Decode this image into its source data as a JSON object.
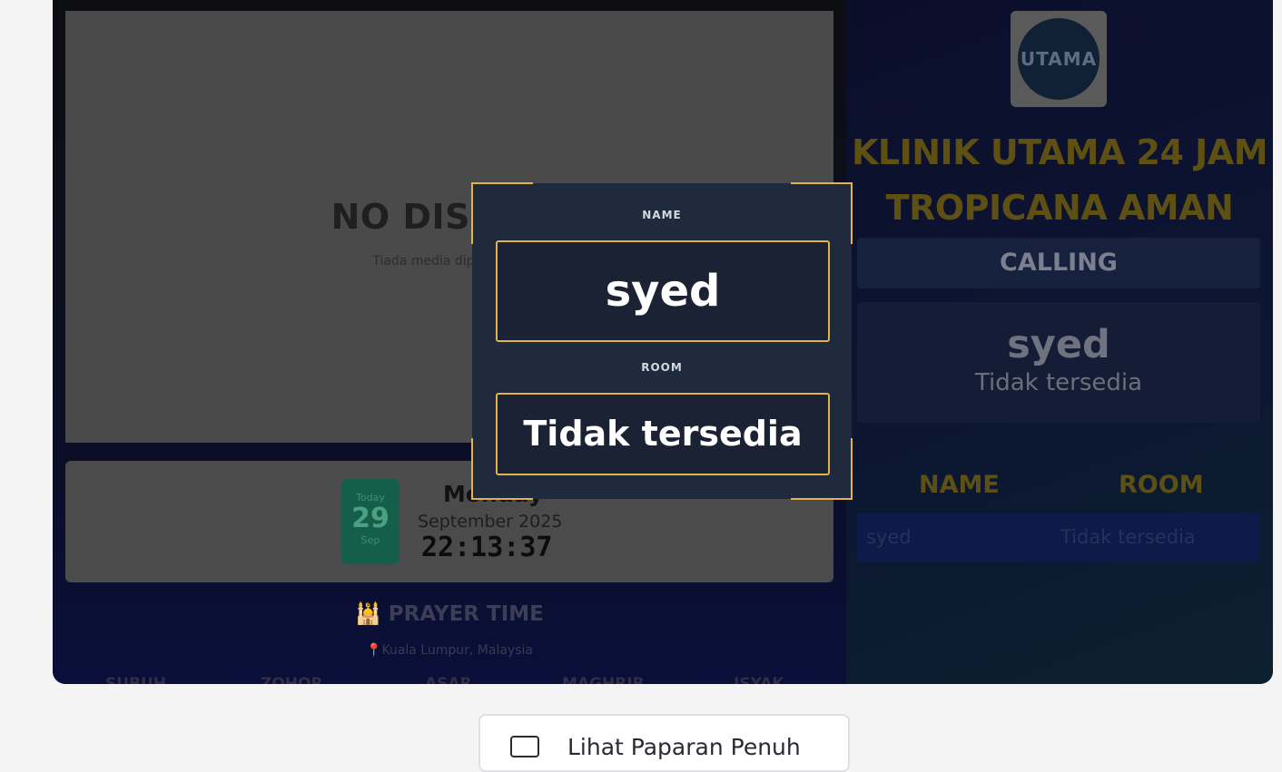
{
  "media": {
    "title": "NO DISPLAY",
    "subtitle": "Tiada media dipaparkan"
  },
  "date": {
    "today_label": "Today",
    "day_number": "29",
    "month_short": "Sep",
    "day_name": "Monday",
    "month_year": "September 2025",
    "time": "22:13:37"
  },
  "prayer": {
    "title": "🕌 PRAYER TIME",
    "location": "📍Kuala Lumpur, Malaysia",
    "names": [
      "SUBUH",
      "ZOHOR",
      "ASAR",
      "MAGHRIB",
      "ISYAK"
    ]
  },
  "clinic": {
    "logo_text": "UTAMA",
    "name": "KLINIK UTAMA 24 JAM TROPICANA AMAN"
  },
  "calling": {
    "header": "CALLING",
    "current_name": "syed",
    "current_room": "Tidak tersedia"
  },
  "queue": {
    "columns": [
      "NAME",
      "ROOM"
    ],
    "rows": [
      {
        "name": "syed",
        "room": "Tidak tersedia"
      }
    ]
  },
  "modal": {
    "name_label": "NAME",
    "name_value": "syed",
    "room_label": "ROOM",
    "room_value": "Tidak tersedia",
    "accent_color": "#e2b34b"
  },
  "actions": {
    "fullview_label": "Lihat Paparan Penuh",
    "fullview_icon": "monitor-icon"
  }
}
